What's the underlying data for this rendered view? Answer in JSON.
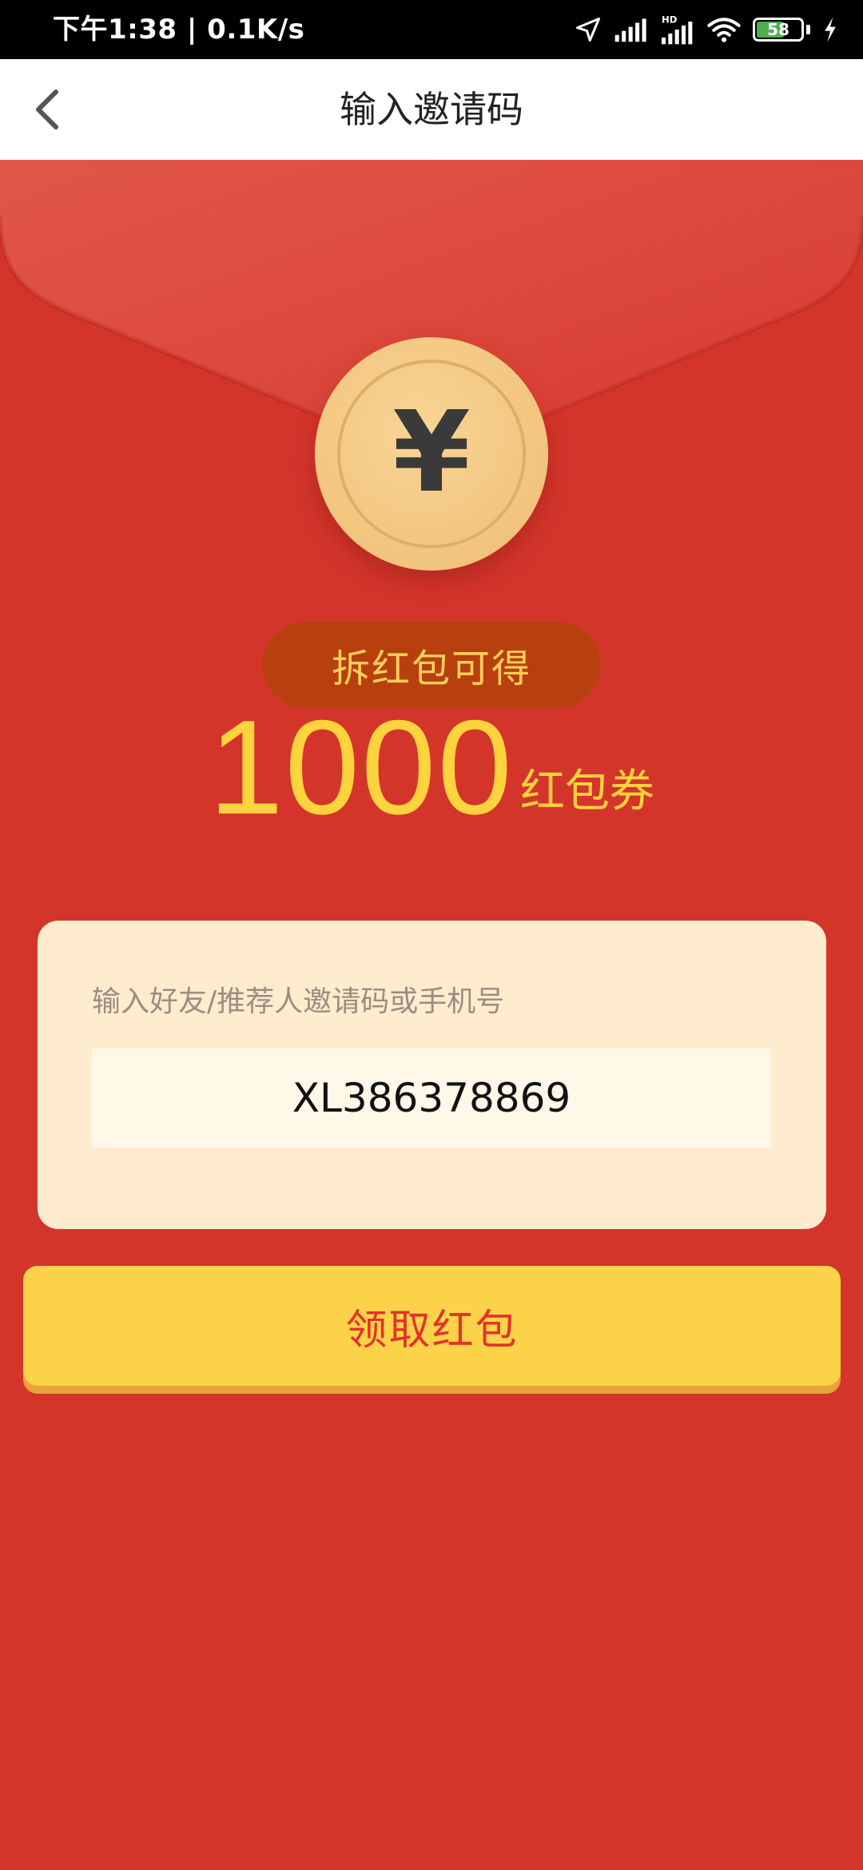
{
  "status_bar": {
    "time_speed": "下午1:38 | 0.1K/s",
    "battery_level": "58",
    "icons": [
      "location-icon",
      "signal-icon",
      "hd-signal-icon",
      "wifi-icon",
      "battery-icon",
      "charging-icon"
    ]
  },
  "nav": {
    "title": "输入邀请码",
    "back_icon": "chevron-left-icon"
  },
  "coin": {
    "symbol": "¥"
  },
  "promo": {
    "caption": "拆红包可得",
    "amount": "1000",
    "unit": "红包券"
  },
  "invite": {
    "label": "输入好友/推荐人邀请码或手机号",
    "value": "XL386378869"
  },
  "claim": {
    "label": "领取红包"
  },
  "colors": {
    "background_red": "#d4352b",
    "flap_red": "#de4b3f",
    "coin_gold": "#f2c47d",
    "pill_brown": "#b8400f",
    "amount_yellow": "#ffd33d",
    "card_cream": "#ffeccf",
    "button_yellow": "#fcd348",
    "button_text_red": "#e2332a"
  }
}
